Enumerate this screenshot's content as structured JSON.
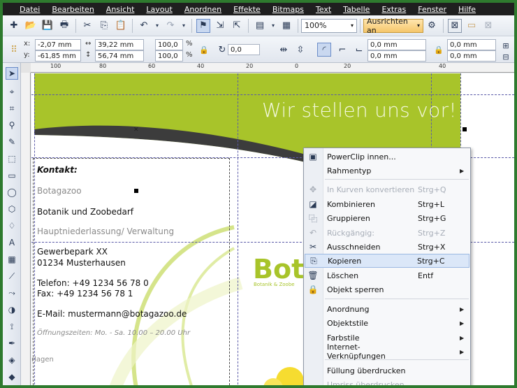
{
  "menu": [
    "Datei",
    "Bearbeiten",
    "Ansicht",
    "Layout",
    "Anordnen",
    "Effekte",
    "Bitmaps",
    "Text",
    "Tabelle",
    "Extras",
    "Fenster",
    "Hilfe"
  ],
  "toolbar": {
    "zoom": "100%",
    "snap_label": "Ausrichten an"
  },
  "props": {
    "x_label": "x:",
    "x_value": "-2,07 mm",
    "y_label": "y:",
    "y_value": "-61,85 mm",
    "w_value": "39,22 mm",
    "h_value": "56,74 mm",
    "scale_x": "100,0",
    "scale_y": "100,0",
    "pct": "%",
    "rotation": "0,0",
    "corner1": "0,0 mm",
    "corner2": "0,0 mm",
    "corner3": "0,0 mm",
    "corner4": "0,0 mm"
  },
  "ruler_h": [
    "100",
    "80",
    "60",
    "40",
    "20",
    "0",
    "20",
    "40"
  ],
  "document": {
    "banner_title": "Wir stellen uns vor!",
    "contact_heading": "Kontakt:",
    "company_short": "Botagazoo",
    "company_full": "Botanik und Zoobedarf",
    "office": "Hauptniederlassung/ Verwaltung",
    "street": "Gewerbepark XX",
    "city": "01234 Musterhausen",
    "phone": "Telefon: +49 1234 56 78 0",
    "fax": "Fax: +49 1234 56 78 1",
    "email": "E-Mail: mustermann@botagazoo.de",
    "hours": "Öffnungszeiten: Mo. - Sa.    10.00 – 20.00 Uhr",
    "footer_fragment": "rlagen",
    "logo_text": "Bota",
    "logo_sub": "Botanik & Zoobe"
  },
  "context_menu": [
    {
      "label": "PowerClip innen...",
      "shortcut": "",
      "icon": "powerclip-icon",
      "glyph": "▣",
      "submenu": false,
      "disabled": false
    },
    {
      "label": "Rahmentyp",
      "shortcut": "",
      "icon": "",
      "glyph": "",
      "submenu": true,
      "disabled": false
    },
    {
      "label": "In Kurven konvertieren",
      "shortcut": "Strg+Q",
      "icon": "convert-curves-icon",
      "glyph": "✥",
      "submenu": false,
      "disabled": true
    },
    {
      "label": "Kombinieren",
      "shortcut": "Strg+L",
      "icon": "combine-icon",
      "glyph": "◪",
      "submenu": false,
      "disabled": false
    },
    {
      "label": "Gruppieren",
      "shortcut": "Strg+G",
      "icon": "group-icon",
      "glyph": "⿻",
      "submenu": false,
      "disabled": false
    },
    {
      "label": "Rückgängig:",
      "shortcut": "Strg+Z",
      "icon": "undo-icon",
      "glyph": "↶",
      "submenu": false,
      "disabled": true
    },
    {
      "label": "Ausschneiden",
      "shortcut": "Strg+X",
      "icon": "cut-icon",
      "glyph": "✂",
      "submenu": false,
      "disabled": false
    },
    {
      "label": "Kopieren",
      "shortcut": "Strg+C",
      "icon": "copy-icon",
      "glyph": "⎘",
      "submenu": false,
      "disabled": false,
      "highlight": true
    },
    {
      "label": "Löschen",
      "shortcut": "Entf",
      "icon": "delete-icon",
      "glyph": "🗑",
      "submenu": false,
      "disabled": false
    },
    {
      "label": "Objekt sperren",
      "shortcut": "",
      "icon": "lock-icon",
      "glyph": "🔒",
      "submenu": false,
      "disabled": false
    },
    {
      "label": "Anordnung",
      "shortcut": "",
      "icon": "",
      "glyph": "",
      "submenu": true,
      "disabled": false
    },
    {
      "label": "Objektstile",
      "shortcut": "",
      "icon": "",
      "glyph": "",
      "submenu": true,
      "disabled": false
    },
    {
      "label": "Farbstile",
      "shortcut": "",
      "icon": "",
      "glyph": "",
      "submenu": true,
      "disabled": false
    },
    {
      "label": "Internet-Verknüpfungen",
      "shortcut": "",
      "icon": "",
      "glyph": "",
      "submenu": true,
      "disabled": false
    },
    {
      "label": "Füllung überdrucken",
      "shortcut": "",
      "icon": "",
      "glyph": "",
      "submenu": false,
      "disabled": false
    },
    {
      "label": "Umriss überdrucken",
      "shortcut": "",
      "icon": "",
      "glyph": "",
      "submenu": false,
      "disabled": true
    }
  ],
  "colors": {
    "brand_green": "#a8c42a",
    "swoosh": "#3c3c3c",
    "frame_green": "#2e7a2e"
  }
}
